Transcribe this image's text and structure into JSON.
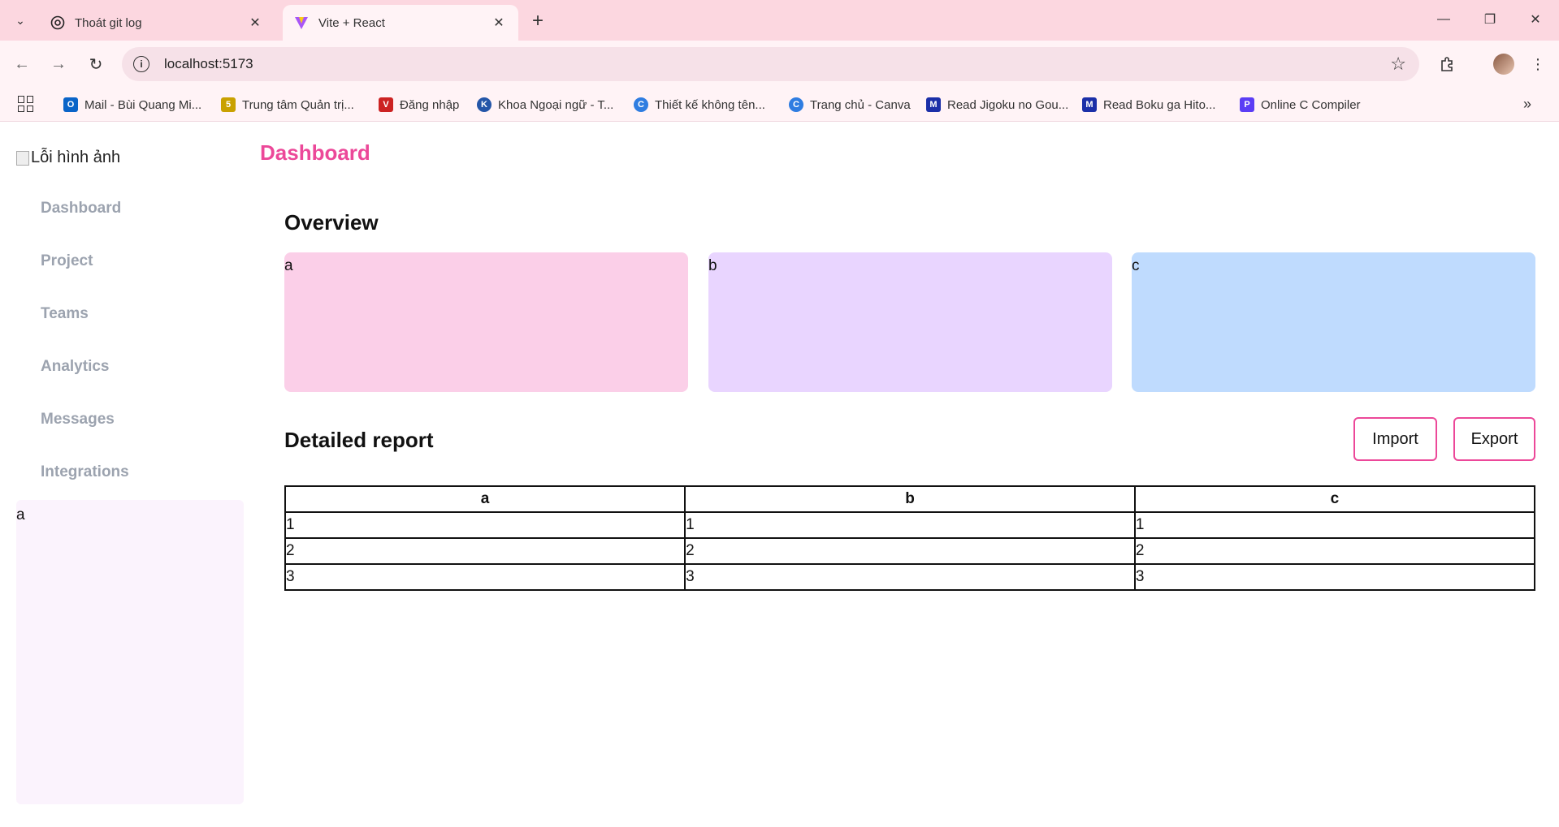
{
  "browser": {
    "tabs": [
      {
        "title": "Thoát git log",
        "active": false,
        "favicon": "openai-icon"
      },
      {
        "title": "Vite + React",
        "active": true,
        "favicon": "vite-icon"
      }
    ],
    "url": "localhost:5173",
    "bookmarks": [
      {
        "label": "Mail - Bùi Quang Mi...",
        "icon": "outlook-icon",
        "color": "#0a64c8"
      },
      {
        "label": "Trung tâm Quản trị...",
        "icon": "admin-icon",
        "color": "#c9a100"
      },
      {
        "label": "Đăng nhập",
        "icon": "login-icon",
        "color": "#cc2222"
      },
      {
        "label": "Khoa Ngoại ngữ - T...",
        "icon": "school-icon",
        "color": "#2456a8"
      },
      {
        "label": "Thiết kế không tên...",
        "icon": "canva-icon",
        "color": "#2f7de1"
      },
      {
        "label": "Trang chủ - Canva",
        "icon": "canva-icon",
        "color": "#2f7de1"
      },
      {
        "label": "Read Jigoku no Gou...",
        "icon": "manga-icon",
        "color": "#1b2fa8"
      },
      {
        "label": "Read Boku ga Hito...",
        "icon": "manga-icon",
        "color": "#1b2fa8"
      },
      {
        "label": "Online C Compiler",
        "icon": "compiler-icon",
        "color": "#5b3df5"
      }
    ]
  },
  "sidebar": {
    "logo_alt": "Lỗi hình ảnh",
    "items": [
      {
        "label": "Dashboard"
      },
      {
        "label": "Project"
      },
      {
        "label": "Teams"
      },
      {
        "label": "Analytics"
      },
      {
        "label": "Messages"
      },
      {
        "label": "Integrations"
      }
    ],
    "panel_text": "a"
  },
  "main": {
    "title": "Dashboard",
    "overview_title": "Overview",
    "cards": [
      {
        "label": "a",
        "color": "#fbcfe8"
      },
      {
        "label": "b",
        "color": "#e9d5ff"
      },
      {
        "label": "c",
        "color": "#bfdbfe"
      }
    ],
    "report_title": "Detailed report",
    "import_label": "Import",
    "export_label": "Export",
    "table": {
      "headers": [
        "a",
        "b",
        "c"
      ],
      "rows": [
        [
          "1",
          "1",
          "1"
        ],
        [
          "2",
          "2",
          "2"
        ],
        [
          "3",
          "3",
          "3"
        ]
      ]
    }
  },
  "colors": {
    "accent": "#ec4899",
    "nav_text": "#9ca3af",
    "chrome": "#fcd7e0"
  }
}
